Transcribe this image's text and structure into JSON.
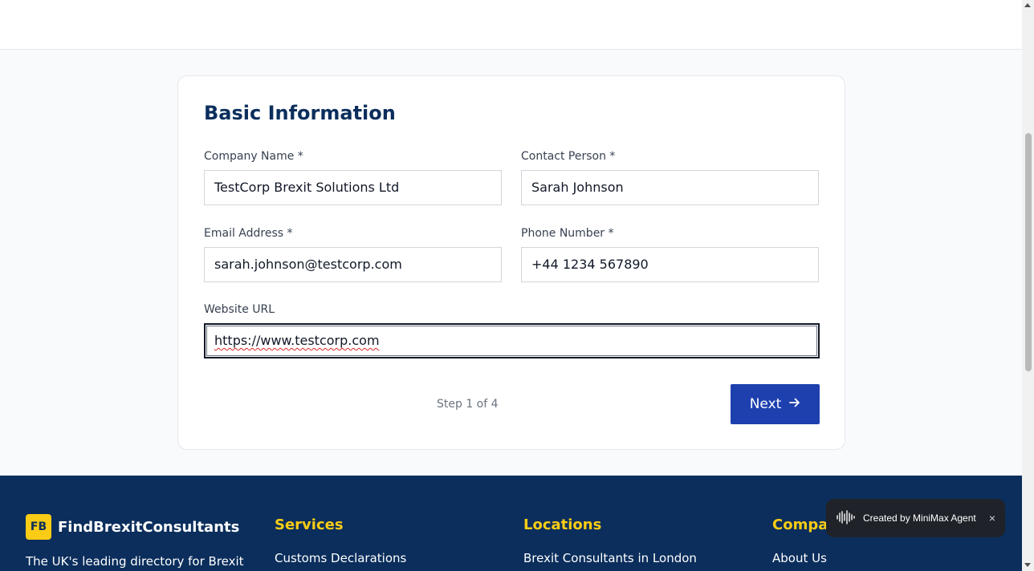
{
  "form": {
    "title": "Basic Information",
    "fields": {
      "company_name": {
        "label": "Company Name *",
        "value": "TestCorp Brexit Solutions Ltd"
      },
      "contact_person": {
        "label": "Contact Person *",
        "value": "Sarah Johnson"
      },
      "email": {
        "label": "Email Address *",
        "value": "sarah.johnson@testcorp.com"
      },
      "phone": {
        "label": "Phone Number *",
        "value": "+44 1234 567890"
      },
      "website": {
        "label": "Website URL",
        "value": "https://www.testcorp.com"
      }
    },
    "step_text": "Step 1 of 4",
    "next_label": "Next"
  },
  "footer": {
    "logo_text": "FB",
    "brand_name": "FindBrexitConsultants",
    "brand_desc": "The UK's leading directory for Brexit",
    "columns": [
      {
        "title": "Services",
        "first_link": "Customs Declarations"
      },
      {
        "title": "Locations",
        "first_link": "Brexit Consultants in London"
      },
      {
        "title": "Company",
        "first_link": "About Us"
      }
    ]
  },
  "toast": {
    "text": "Created by MiniMax Agent",
    "close": "×"
  },
  "colors": {
    "primary": "#1e40af",
    "navy": "#0b2e5c",
    "accent": "#facc15"
  }
}
